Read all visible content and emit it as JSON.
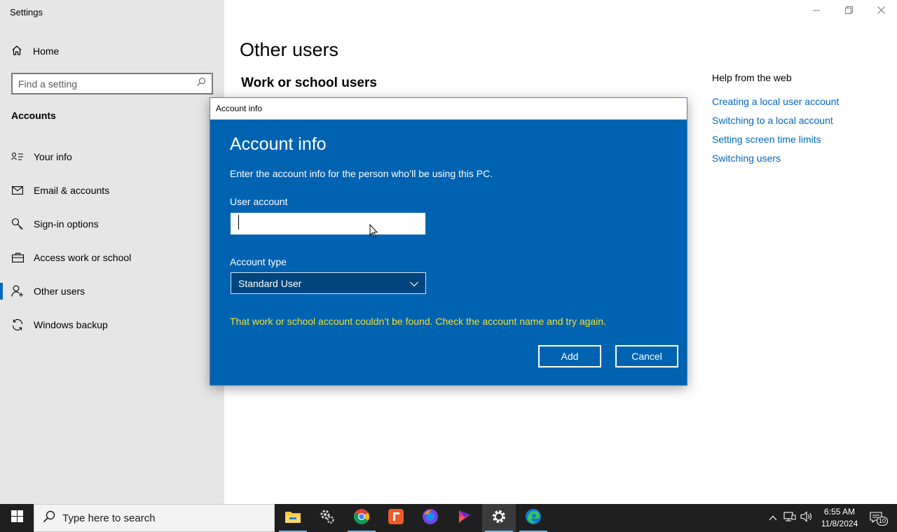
{
  "app": {
    "title": "Settings"
  },
  "sidebar": {
    "home_label": "Home",
    "search_placeholder": "Find a setting",
    "section_title": "Accounts",
    "items": [
      {
        "label": "Your info",
        "icon": "person-card-icon",
        "selected": false
      },
      {
        "label": "Email & accounts",
        "icon": "mail-icon",
        "selected": false
      },
      {
        "label": "Sign-in options",
        "icon": "key-icon",
        "selected": false
      },
      {
        "label": "Access work or school",
        "icon": "briefcase-icon",
        "selected": false
      },
      {
        "label": "Other users",
        "icon": "person-add-icon",
        "selected": true
      },
      {
        "label": "Windows backup",
        "icon": "sync-icon",
        "selected": false
      }
    ]
  },
  "main": {
    "title": "Other users",
    "subtitle": "Work or school users"
  },
  "help": {
    "title": "Help from the web",
    "links": [
      "Creating a local user account",
      "Switching to a local account",
      "Setting screen time limits",
      "Switching users"
    ]
  },
  "dialog": {
    "window_title": "Account info",
    "heading": "Account info",
    "description": "Enter the account info for the person who’ll be using this PC.",
    "user_account_label": "User account",
    "user_account_value": "",
    "account_type_label": "Account type",
    "account_type_value": "Standard User",
    "error": "That work or school account couldn’t be found. Check the account name and try again.",
    "add_label": "Add",
    "cancel_label": "Cancel"
  },
  "taskbar": {
    "search_placeholder": "Type here to search",
    "apps": [
      "file-explorer-icon",
      "control-panel-icon",
      "chrome-icon",
      "foxit-icon",
      "firefox-icon",
      "media-app-icon",
      "settings-icon",
      "edge-icon"
    ],
    "time": "6:55 AM",
    "date": "11/8/2024",
    "notification_count": "10"
  },
  "colors": {
    "accent": "#0067c0",
    "dialog_bg": "#0063b1",
    "error_text": "#f0e130",
    "sidebar_bg": "#e6e6e6",
    "taskbar_bg": "#1f1f1f"
  }
}
